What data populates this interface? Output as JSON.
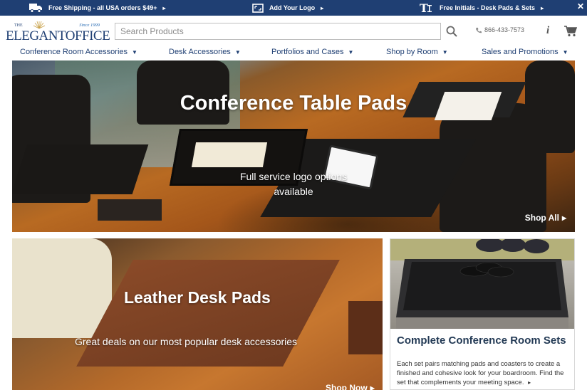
{
  "promo": {
    "items": [
      {
        "icon": "truck-icon",
        "text": "Free Shipping - all USA orders $49+"
      },
      {
        "icon": "logo-frame-icon",
        "text": "Add Your Logo"
      },
      {
        "icon": "initials-icon",
        "text": "Free Initials - Desk Pads & Sets"
      }
    ],
    "close": "✕"
  },
  "header": {
    "logo": {
      "the": "THE",
      "word": "ELEGANTOFFICE",
      "since": "Since 1999"
    },
    "search": {
      "placeholder": "Search Products",
      "value": ""
    },
    "phone": "866-433-7573",
    "info": "i"
  },
  "nav": {
    "items": [
      {
        "label": "Conference Room Accessories"
      },
      {
        "label": "Desk Accessories"
      },
      {
        "label": "Portfolios and Cases"
      },
      {
        "label": "Shop by Room"
      },
      {
        "label": "Sales and Promotions"
      }
    ]
  },
  "hero": {
    "title": "Conference Table Pads",
    "subtitle": "Full service logo options available",
    "cta": "Shop All"
  },
  "tiles": {
    "pads": {
      "title": "Leather Desk Pads",
      "subtitle": "Great deals on our most popular desk accessories",
      "cta": "Shop Now"
    },
    "sets": {
      "title": "Complete Conference Room Sets",
      "description": "Each set pairs matching pads and coasters to create a finished and cohesive look for your boardroom. Find the set that complements your meeting space."
    }
  },
  "colors": {
    "brand_navy": "#1f3f73",
    "link_blue": "#1f3f73"
  }
}
